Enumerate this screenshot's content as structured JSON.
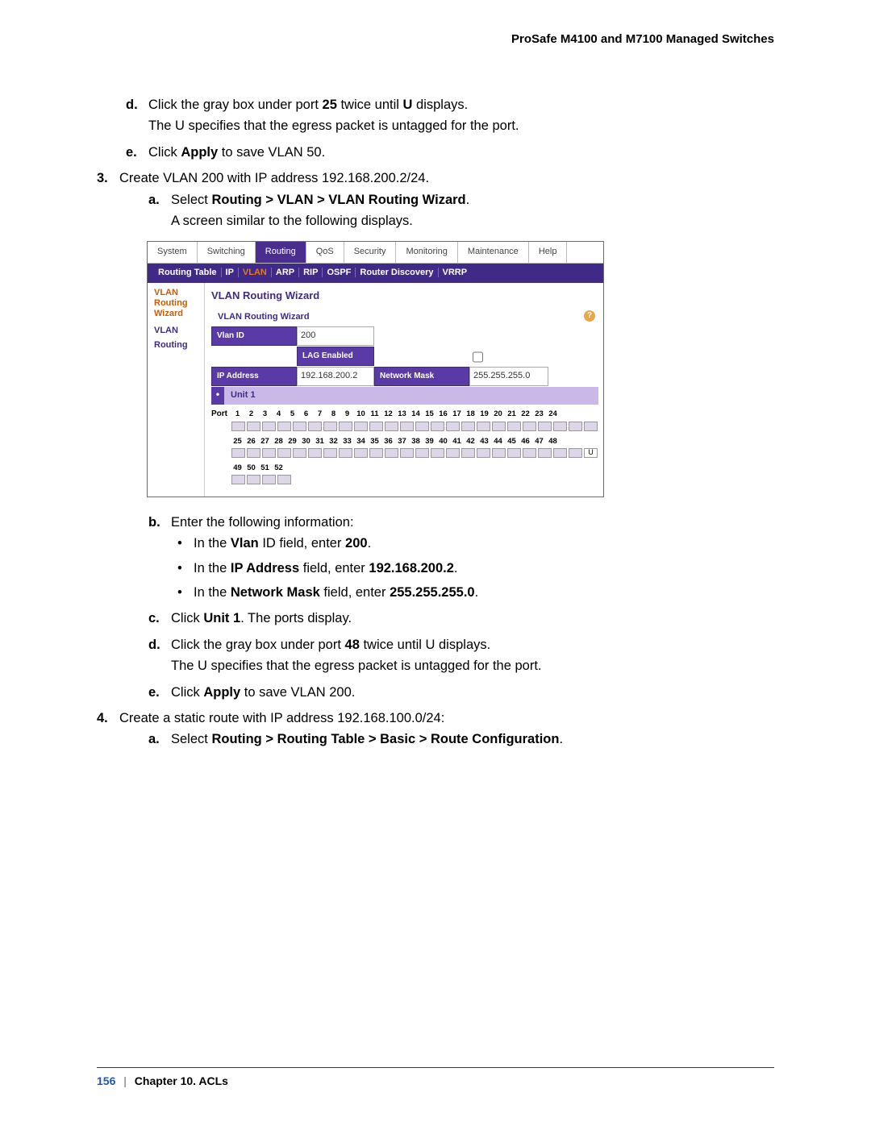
{
  "header": {
    "title": "ProSafe M4100 and M7100 Managed Switches"
  },
  "doc": {
    "d_text_prefix": "Click the gray box under port ",
    "d_port": "25",
    "d_mid": " twice until ",
    "d_letter": "U",
    "d_suffix": " displays.",
    "d_note": "The U specifies that the egress packet is untagged for the port.",
    "e_prefix": "Click ",
    "e_apply": "Apply",
    "e_suffix50": " to save VLAN 50.",
    "step3": "Create VLAN 200 with IP address 192.168.200.2/24.",
    "a3_prefix": "Select ",
    "a3_path": "Routing > VLAN > VLAN Routing Wizard",
    "a3_dot": ".",
    "a3_note": "A screen similar to the following displays.",
    "b_text": "Enter the following information:",
    "b1_pre": "In the ",
    "b1_b": "Vlan",
    "b1_mid": " ID field, enter ",
    "b1_val": "200",
    "b1_post": ".",
    "b2_pre": "In the ",
    "b2_b": "IP Address",
    "b2_mid": " field, enter ",
    "b2_val": "192.168.200.2",
    "b2_post": ".",
    "b3_pre": "In the ",
    "b3_b": "Network Mask",
    "b3_mid": " field, enter ",
    "b3_val": "255.255.255.0",
    "b3_post": ".",
    "c_prefix": "Click ",
    "c_unit": "Unit 1",
    "c_suffix": ". The ports display.",
    "d2_prefix": "Click the gray box under port ",
    "d2_port": "48",
    "d2_suffix": " twice until U displays.",
    "d2_note": "The U specifies that the egress packet is untagged for the port.",
    "e2_prefix": "Click ",
    "e2_apply": "Apply",
    "e2_suffix": " to save VLAN 200.",
    "step4": "Create a static route with IP address 192.168.100.0/24:",
    "a4_prefix": "Select ",
    "a4_path": "Routing > Routing Table > Basic > Route Configuration",
    "a4_dot": "."
  },
  "fig": {
    "tabs": [
      "System",
      "Switching",
      "Routing",
      "QoS",
      "Security",
      "Monitoring",
      "Maintenance",
      "Help"
    ],
    "active_tab_index": 2,
    "subnav": [
      "Routing Table",
      "IP",
      "VLAN",
      "ARP",
      "RIP",
      "OSPF",
      "Router Discovery",
      "VRRP"
    ],
    "subnav_vlan_index": 2,
    "side": {
      "sel_line1": "VLAN Routing",
      "sel_line2": "Wizard",
      "unsel": "VLAN Routing"
    },
    "panel_heading": "VLAN Routing Wizard",
    "panel_title": "VLAN Routing Wizard",
    "help_glyph": "?",
    "fields": {
      "vlan_id_label": "Vlan ID",
      "vlan_id_value": "200",
      "lag_label": "LAG Enabled",
      "ip_label": "IP Address",
      "ip_value": "192.168.200.2",
      "mask_label": "Network Mask",
      "mask_value": "255.255.255.0"
    },
    "unit_label": "Unit 1",
    "port_label": "Port",
    "row1_nums": [
      "1",
      "2",
      "3",
      "4",
      "5",
      "6",
      "7",
      "8",
      "9",
      "10",
      "11",
      "12",
      "13",
      "14",
      "15",
      "16",
      "17",
      "18",
      "19",
      "20",
      "21",
      "22",
      "23",
      "24"
    ],
    "row2_nums": [
      "25",
      "26",
      "27",
      "28",
      "29",
      "30",
      "31",
      "32",
      "33",
      "34",
      "35",
      "36",
      "37",
      "38",
      "39",
      "40",
      "41",
      "42",
      "43",
      "44",
      "45",
      "46",
      "47",
      "48"
    ],
    "row3_nums": [
      "49",
      "50",
      "51",
      "52"
    ],
    "marked_port": "U"
  },
  "footer": {
    "page": "156",
    "chapter": "Chapter 10.  ACLs"
  },
  "markers": {
    "d": "d.",
    "e": "e.",
    "n3": "3.",
    "a": "a.",
    "b": "b.",
    "c": "c.",
    "n4": "4."
  }
}
